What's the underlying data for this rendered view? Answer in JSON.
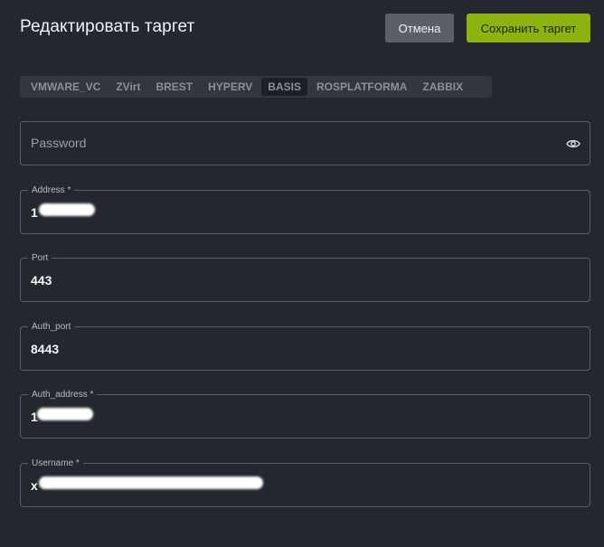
{
  "header": {
    "title": "Редактировать таргет",
    "cancel_label": "Отмена",
    "save_label": "Сохранить таргет"
  },
  "tabs": [
    {
      "label": "VMWARE_VC",
      "active": false
    },
    {
      "label": "ZVirt",
      "active": false
    },
    {
      "label": "BREST",
      "active": false
    },
    {
      "label": "HYPERV",
      "active": false
    },
    {
      "label": "BASIS",
      "active": true
    },
    {
      "label": "ROSPLATFORMA",
      "active": false
    },
    {
      "label": "ZABBIX",
      "active": false
    }
  ],
  "fields": {
    "password": {
      "placeholder": "Password",
      "icon": "eye-icon"
    },
    "address": {
      "label": "Address *",
      "value": "1"
    },
    "port": {
      "label": "Port",
      "value": "443"
    },
    "auth_port": {
      "label": "Auth_port",
      "value": "8443"
    },
    "auth_address": {
      "label": "Auth_address *",
      "value": "1"
    },
    "username": {
      "label": "Username *",
      "value": "x"
    }
  }
}
